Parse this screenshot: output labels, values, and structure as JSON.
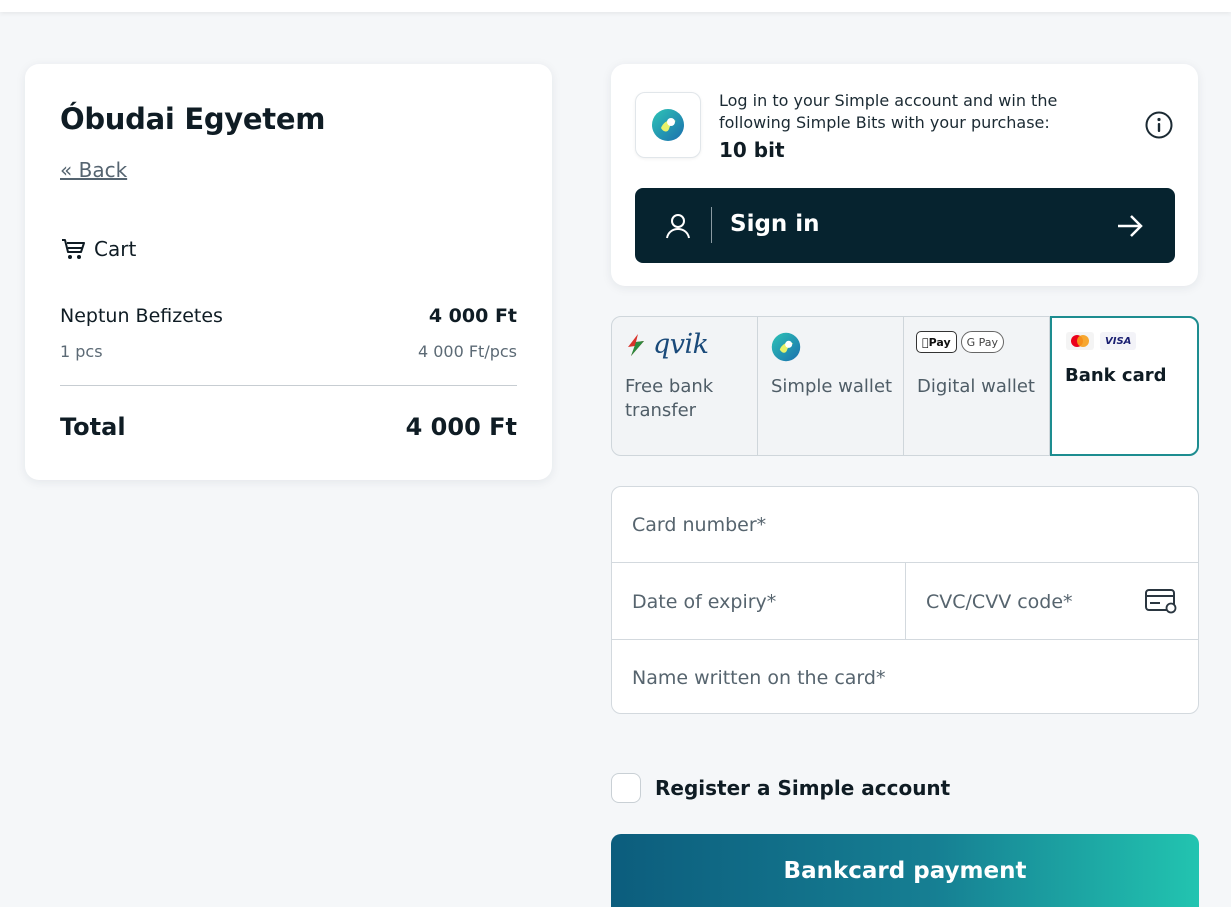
{
  "merchant": {
    "name": "Óbudai Egyetem",
    "back_label": "« Back",
    "cart_label": "Cart",
    "items": [
      {
        "name": "Neptun Befizetes",
        "price": "4 000 Ft",
        "qty": "1 pcs",
        "unit_price": "4 000 Ft/pcs"
      }
    ],
    "total_label": "Total",
    "total_value": "4 000 Ft"
  },
  "signin": {
    "promo_text": "Log in to your Simple account and win the following Simple Bits with your purchase:",
    "bits": "10 bit",
    "button_label": "Sign in"
  },
  "payment_methods": [
    {
      "id": "qvik",
      "logo_text": "qvik",
      "label": "Free bank transfer",
      "selected": false
    },
    {
      "id": "simple",
      "label": "Simple wallet",
      "selected": false
    },
    {
      "id": "digital",
      "badges": [
        "Pay",
        "G Pay"
      ],
      "label": "Digital wallet",
      "selected": false
    },
    {
      "id": "card",
      "badges": [
        "VISA"
      ],
      "label": "Bank card",
      "selected": true
    }
  ],
  "card_form": {
    "number_placeholder": "Card number*",
    "expiry_placeholder": "Date of expiry*",
    "cvc_placeholder": "CVC/CVV code*",
    "name_placeholder": "Name written on the card*"
  },
  "register": {
    "label": "Register a Simple account",
    "checked": false
  },
  "pay_button": {
    "label": "Bankcard payment"
  },
  "colors": {
    "dark_button": "#06232f",
    "accent_border": "#1d8d90",
    "pay_gradient_start": "#0c5d7d",
    "pay_gradient_end": "#22c4b0"
  }
}
